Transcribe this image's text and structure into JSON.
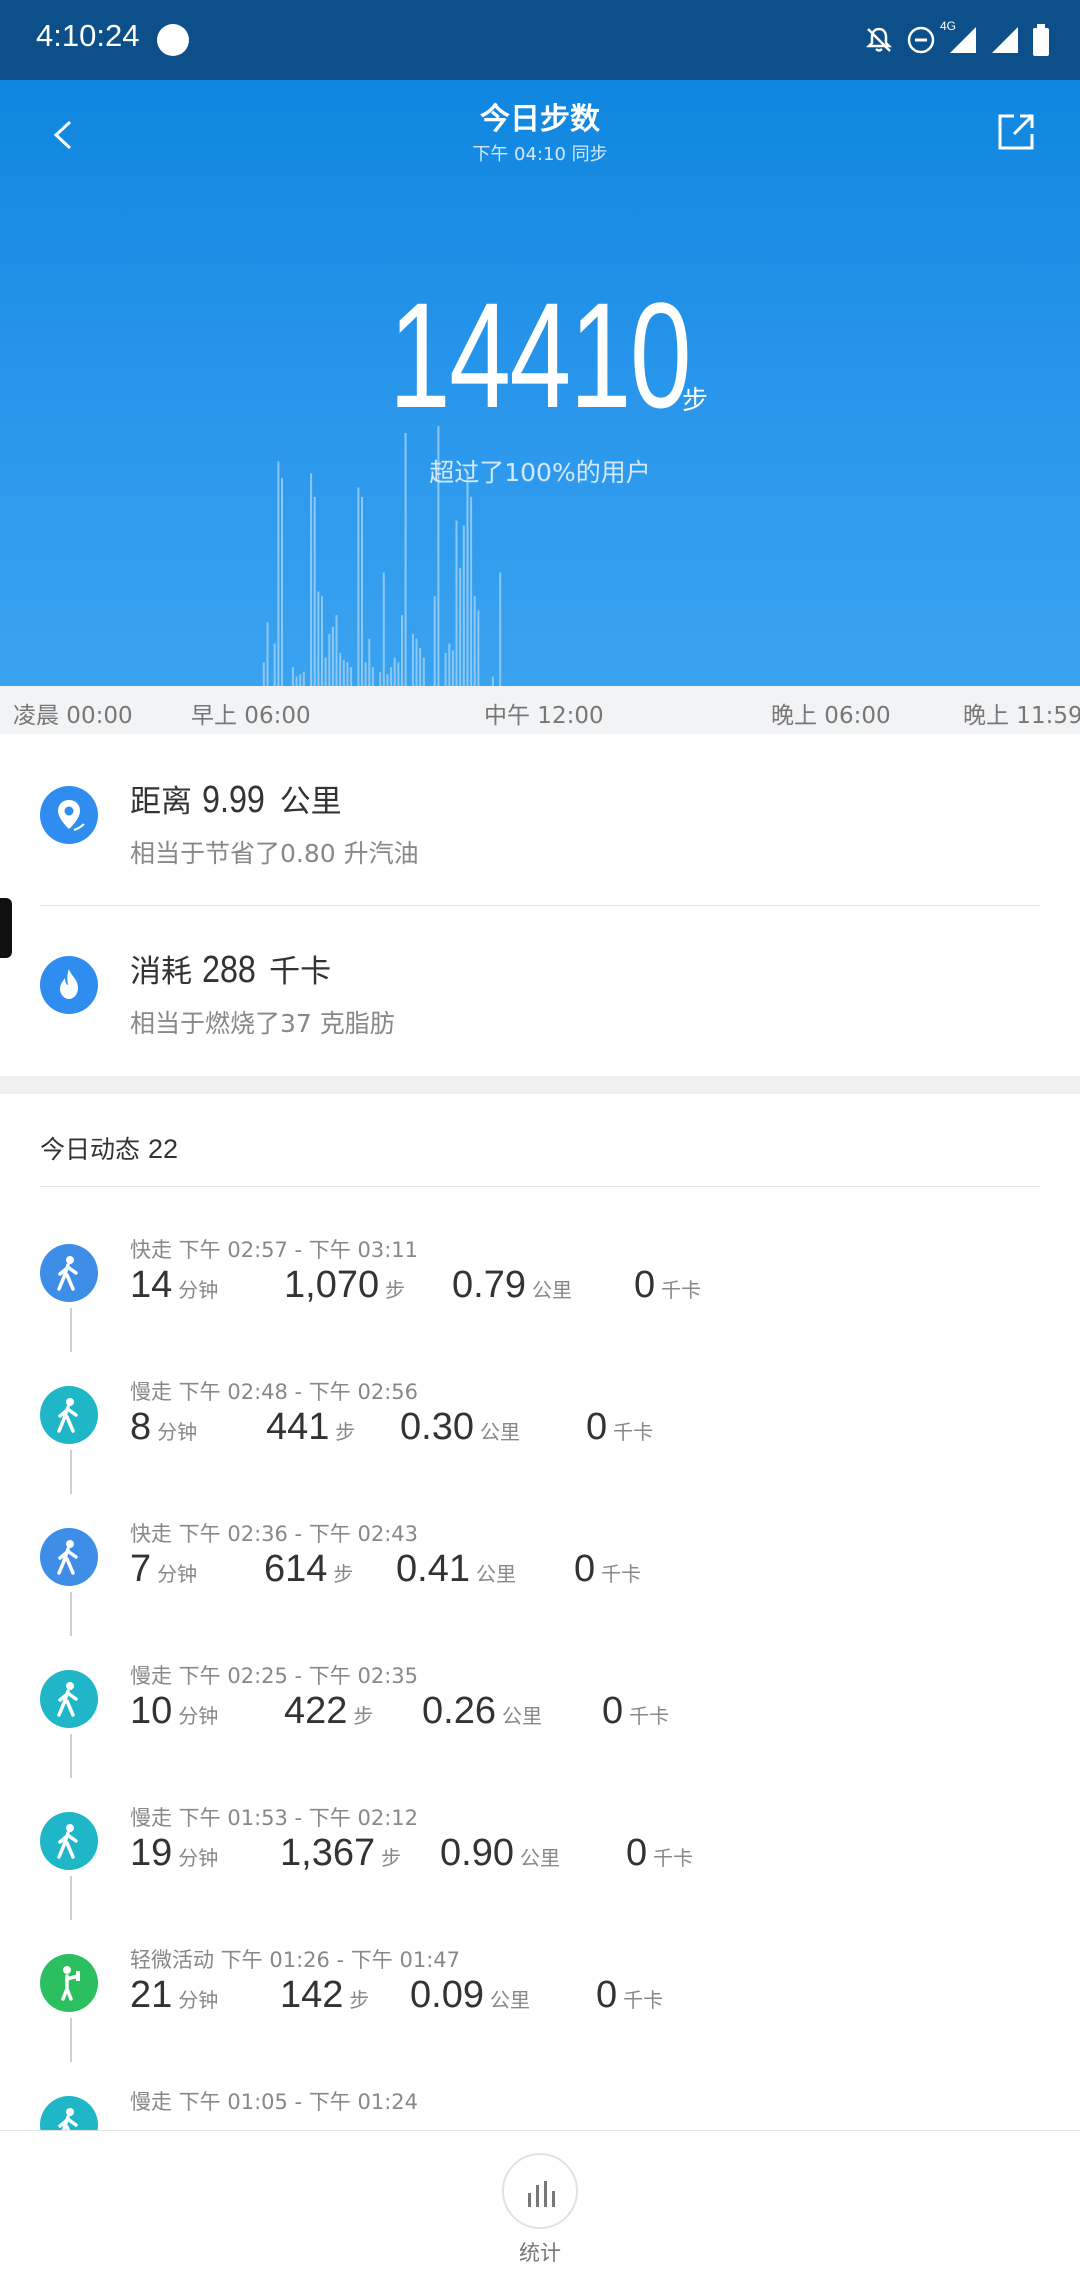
{
  "status_bar": {
    "time": "4:10:24",
    "network": "4G"
  },
  "header": {
    "title": "今日步数",
    "subtitle": "下午 04:10 同步"
  },
  "summary": {
    "steps": "14410",
    "steps_unit": "步",
    "rank_text": "超过了100%的用户"
  },
  "chart_data": {
    "type": "bar",
    "title": "",
    "x_tick_labels": [
      "凌晨 00:00",
      "早上 06:00",
      "中午 12:00",
      "晚上 06:00",
      "晚上 11:59"
    ],
    "x_range_minutes": [
      0,
      1439
    ],
    "y_unit": "步",
    "bar_color": "#8cc8f5",
    "values": [
      0,
      0,
      0,
      0,
      0,
      0,
      0,
      0,
      0,
      0,
      0,
      0,
      0,
      0,
      0,
      0,
      0,
      0,
      0,
      0,
      0,
      0,
      0,
      0,
      0,
      0,
      0,
      0,
      0,
      0,
      0,
      0,
      0,
      0,
      0,
      0,
      0,
      0,
      0,
      0,
      0,
      0,
      0,
      0,
      0,
      0,
      0,
      0,
      0,
      0,
      0,
      0,
      0,
      0,
      0,
      0,
      0,
      0,
      0,
      0,
      0,
      0,
      0,
      0,
      0,
      0,
      0,
      0,
      0,
      0,
      0,
      0,
      10,
      27,
      0,
      18,
      95,
      88,
      0,
      0,
      8,
      4,
      5,
      6,
      0,
      90,
      80,
      40,
      38,
      12,
      22,
      25,
      30,
      14,
      11,
      10,
      8,
      0,
      84,
      80,
      10,
      20,
      8,
      0,
      6,
      48,
      5,
      8,
      12,
      10,
      30,
      107,
      0,
      22,
      20,
      16,
      12,
      0,
      0,
      38,
      110,
      0,
      14,
      18,
      15,
      70,
      50,
      68,
      90,
      80,
      38,
      32,
      0,
      0,
      0,
      4,
      0,
      48,
      0,
      0,
      0,
      0,
      0,
      0,
      0,
      0,
      0,
      0,
      0,
      0,
      0,
      0,
      0,
      0,
      0,
      0,
      0,
      0,
      0,
      0,
      0,
      0,
      0,
      0,
      0,
      0,
      0,
      0,
      0,
      0,
      0,
      0,
      0,
      0,
      0,
      0,
      0,
      0,
      0,
      0,
      0,
      0,
      0,
      0,
      0,
      0,
      0,
      0,
      0,
      0,
      0,
      0,
      0,
      0,
      0,
      0,
      0,
      0,
      0,
      0,
      0,
      0,
      0,
      0,
      0,
      0,
      0,
      0,
      0,
      0,
      0,
      0,
      0,
      0,
      0,
      0,
      0,
      0,
      0,
      0,
      0,
      0,
      0,
      0,
      0,
      0,
      0,
      0,
      0,
      0,
      0,
      0,
      0,
      0,
      0,
      0,
      0,
      0,
      0,
      0,
      0,
      0,
      0,
      0,
      0,
      0,
      0,
      0,
      0,
      0,
      0,
      0,
      0,
      0,
      0,
      0,
      0,
      0,
      0,
      0,
      0,
      0,
      0,
      0,
      0,
      0,
      0,
      0,
      0,
      0,
      0,
      0,
      0,
      0,
      0,
      0,
      0,
      0,
      0,
      0,
      0,
      0,
      0,
      0,
      0,
      0,
      0,
      0,
      0,
      0,
      0,
      0,
      0,
      0,
      0,
      0,
      0
    ]
  },
  "distance": {
    "label": "距离",
    "value": "9.99",
    "unit": "公里",
    "sub": "相当于节省了0.80 升汽油"
  },
  "calories": {
    "label": "消耗",
    "value": "288",
    "unit": "千卡",
    "sub": "相当于燃烧了37 克脂肪"
  },
  "activity_section": {
    "title": "今日动态",
    "count": "22"
  },
  "activities": [
    {
      "head": "快走 下午 02:57 - 下午 03:11",
      "duration": "14",
      "steps": "1,070",
      "distance": "0.79",
      "kcal": "0",
      "icon": "walk-icon",
      "color": "#3e8ee8"
    },
    {
      "head": "慢走 下午 02:48 - 下午 02:56",
      "duration": "8",
      "steps": "441",
      "distance": "0.30",
      "kcal": "0",
      "icon": "walk-icon",
      "color": "#1fb6c7"
    },
    {
      "head": "快走 下午 02:36 - 下午 02:43",
      "duration": "7",
      "steps": "614",
      "distance": "0.41",
      "kcal": "0",
      "icon": "walk-icon",
      "color": "#3e8ee8"
    },
    {
      "head": "慢走 下午 02:25 - 下午 02:35",
      "duration": "10",
      "steps": "422",
      "distance": "0.26",
      "kcal": "0",
      "icon": "walk-icon",
      "color": "#1fb6c7"
    },
    {
      "head": "慢走 下午 01:53 - 下午 02:12",
      "duration": "19",
      "steps": "1,367",
      "distance": "0.90",
      "kcal": "0",
      "icon": "walk-icon",
      "color": "#1fb6c7"
    },
    {
      "head": "轻微活动 下午 01:26 - 下午 01:47",
      "duration": "21",
      "steps": "142",
      "distance": "0.09",
      "kcal": "0",
      "icon": "light-activity-icon",
      "color": "#2bbf5f"
    },
    {
      "head": "慢走 下午 01:05 - 下午 01:24",
      "duration": "",
      "steps": "",
      "distance": "",
      "kcal": "",
      "icon": "walk-icon",
      "color": "#1fb6c7"
    }
  ],
  "units": {
    "minutes": "分钟",
    "steps": "步",
    "km": "公里",
    "kcal": "千卡"
  },
  "bottom_nav": {
    "stats_label": "统计"
  },
  "colors": {
    "header_blue": "#1a8ce6",
    "status_bar": "#0c4f89"
  }
}
